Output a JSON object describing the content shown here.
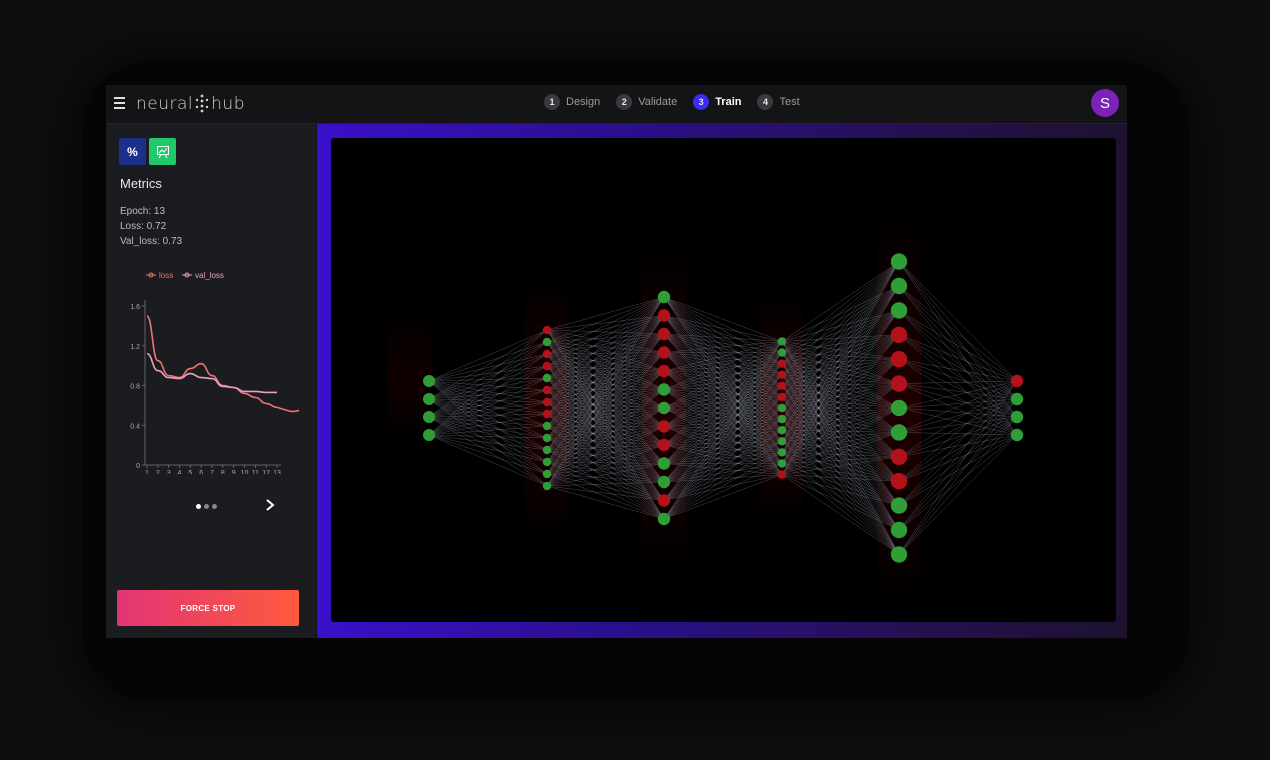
{
  "app": {
    "logo_left": "neural",
    "logo_right": "hub"
  },
  "steps": [
    {
      "num": "1",
      "label": "Design"
    },
    {
      "num": "2",
      "label": "Validate"
    },
    {
      "num": "3",
      "label": "Train",
      "active": true
    },
    {
      "num": "4",
      "label": "Test"
    }
  ],
  "user": {
    "initial": "S"
  },
  "toolbar": {
    "metrics_icon": "%",
    "chart_icon": "chart-icon"
  },
  "metrics": {
    "title": "Metrics",
    "epoch": "Epoch: 13",
    "loss": "Loss: 0.72",
    "val_loss": "Val_loss: 0.73"
  },
  "chart_data": {
    "type": "line",
    "x": [
      1,
      2,
      3,
      4,
      5,
      6,
      7,
      8,
      9,
      10,
      11,
      12,
      13
    ],
    "series": [
      {
        "name": "loss",
        "values": [
          1.5,
          1.05,
          0.9,
          0.88,
          0.97,
          1.02,
          0.9,
          0.8,
          0.78,
          0.72,
          0.68,
          0.62,
          0.58
        ],
        "color": "#f07070"
      },
      {
        "name": "val_loss",
        "values": [
          1.12,
          0.95,
          0.88,
          0.87,
          0.92,
          0.88,
          0.87,
          0.79,
          0.78,
          0.74,
          0.74,
          0.73,
          0.73
        ],
        "color": "#e8a0c0"
      }
    ],
    "ylim": [
      0,
      1.6
    ],
    "yticks": [
      "0",
      "0.4",
      "0.8",
      "1.2",
      "1.6"
    ],
    "xticks": [
      "1",
      "2",
      "3",
      "4",
      "5",
      "6",
      "7",
      "8",
      "9",
      "10",
      "11",
      "12",
      "13"
    ]
  },
  "actions": {
    "force_stop": "FORCE STOP"
  },
  "network": {
    "layers": [
      {
        "nodes": [
          "g",
          "g",
          "g",
          "g"
        ]
      },
      {
        "nodes": [
          "r",
          "g",
          "r",
          "r",
          "g",
          "r",
          "r",
          "r",
          "g",
          "g",
          "g",
          "g",
          "g",
          "g"
        ]
      },
      {
        "nodes": [
          "g",
          "r",
          "r",
          "r",
          "r",
          "g",
          "g",
          "r",
          "r",
          "g",
          "g",
          "r",
          "g"
        ]
      },
      {
        "nodes": [
          "g",
          "g",
          "r",
          "r",
          "r",
          "r",
          "g",
          "g",
          "g",
          "g",
          "g",
          "g",
          "r"
        ]
      },
      {
        "nodes": [
          "g",
          "g",
          "g",
          "r",
          "r",
          "r",
          "g",
          "g",
          "r",
          "r",
          "g",
          "g",
          "g"
        ]
      },
      {
        "nodes": [
          "r",
          "g",
          "g",
          "g"
        ]
      }
    ],
    "colors": {
      "g": "#2f9e36",
      "r": "#b3121a"
    }
  }
}
